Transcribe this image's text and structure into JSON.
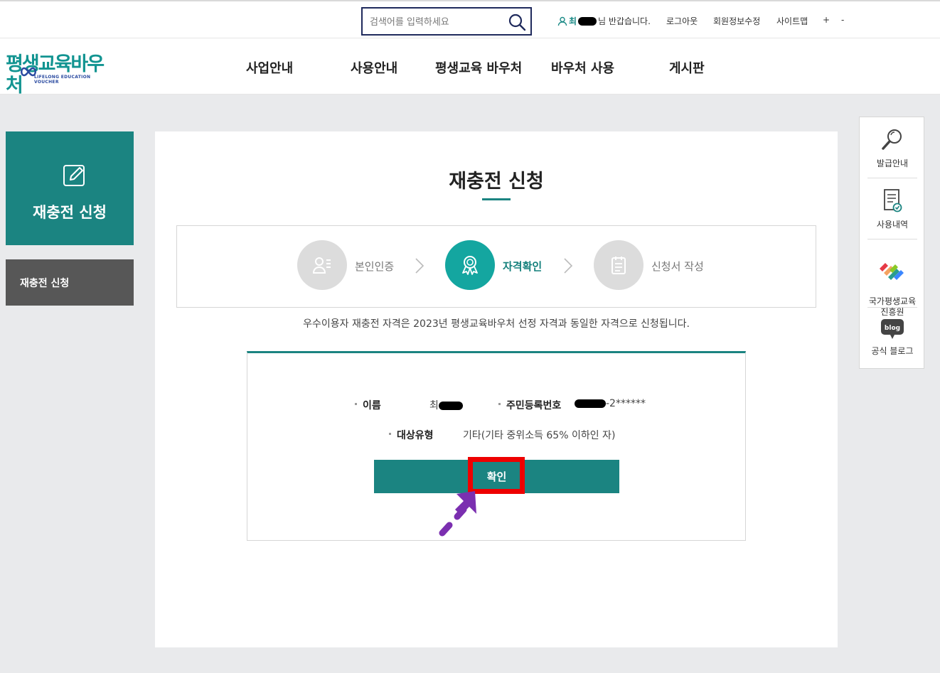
{
  "topbar": {
    "search_placeholder": "검색어를 입력하세요",
    "user_name": "최",
    "greeting": "님 반갑습니다.",
    "links": [
      "로그아웃",
      "회원정보수정",
      "사이트맵",
      "+",
      "-"
    ]
  },
  "logo": {
    "main": "평생교육바우처",
    "sub": "LIFELONG EDUCATION VOUCHER"
  },
  "nav": [
    "사업안내",
    "사용안내",
    "평생교육 바우처",
    "바우처 사용",
    "게시판"
  ],
  "sidebar": {
    "title": "재충전 신청",
    "menu_item": "재충전 신청"
  },
  "main": {
    "title": "재충전 신청",
    "steps": [
      {
        "label": "본인인증",
        "icon": "person-list-icon",
        "active": false
      },
      {
        "label": "자격확인",
        "icon": "award-icon",
        "active": true
      },
      {
        "label": "신청서 작성",
        "icon": "clipboard-icon",
        "active": false
      }
    ],
    "notice": "우수이용자 재충전 자격은 2023년 평생교육바우처 선정 자격과 동일한 자격으로 신청됩니다.",
    "info": {
      "name_label": "이름",
      "name_value": "최",
      "rrn_label": "주민등록번호",
      "rrn_value": "-2******",
      "type_label": "대상유형",
      "type_value": "기타(기타 중위소득 65% 이하인 자)"
    },
    "confirm_label": "확인"
  },
  "quick_menu": [
    {
      "label": "발급안내",
      "icon": "magnifier-icon"
    },
    {
      "label": "사용내역",
      "icon": "document-check-icon"
    },
    {
      "label": "국가평생교육\n진흥원",
      "icon": "nile-logo-icon"
    },
    {
      "label": "공식 블로그",
      "icon": "blog-icon"
    }
  ],
  "colors": {
    "primary": "#1b8481",
    "accent": "#14a6a0",
    "highlight": "#ee0000",
    "arrow": "#7b2fb0"
  }
}
